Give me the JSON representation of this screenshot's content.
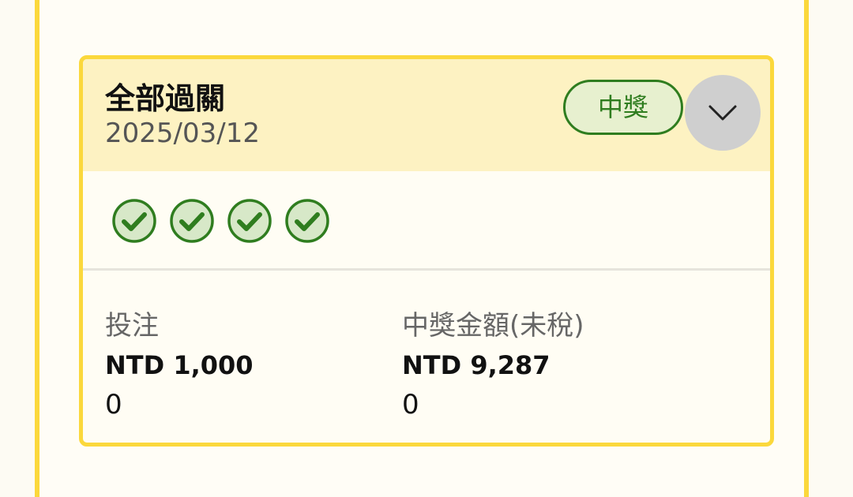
{
  "bet": {
    "type_label": "全部過關",
    "date": "2025/03/12",
    "status": "中獎",
    "legs": [
      {
        "icon": "check-circle-icon",
        "state": "won"
      },
      {
        "icon": "check-circle-icon",
        "state": "won"
      },
      {
        "icon": "check-circle-icon",
        "state": "won"
      },
      {
        "icon": "check-circle-icon",
        "state": "won"
      }
    ],
    "stake": {
      "label": "投注",
      "amount": "NTD 1,000",
      "sub": "0"
    },
    "winnings": {
      "label": "中獎金額(未稅)",
      "amount": "NTD 9,287",
      "sub": "0"
    }
  },
  "colors": {
    "accent_yellow": "#fbd83c",
    "header_bg": "#fdf2c2",
    "win_green": "#2f7d1f",
    "win_green_fill": "#d7e8c8",
    "button_grey": "#cfcfcf"
  },
  "icons": {
    "expand": "chevron-down-icon"
  }
}
